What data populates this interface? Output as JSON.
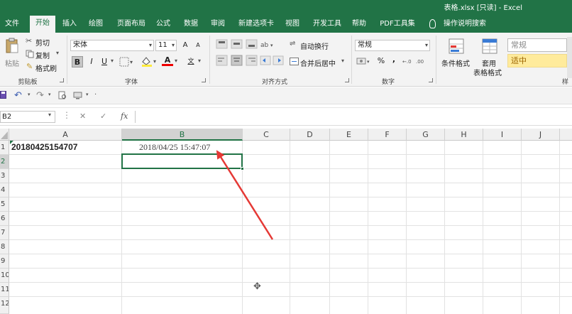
{
  "window": {
    "title": "表格.xlsx  [只读]  -  Excel"
  },
  "tabs": [
    {
      "label": "文件",
      "active": false
    },
    {
      "label": "开始",
      "active": true
    },
    {
      "label": "插入",
      "active": false
    },
    {
      "label": "绘图",
      "active": false
    },
    {
      "label": "页面布局",
      "active": false
    },
    {
      "label": "公式",
      "active": false
    },
    {
      "label": "数据",
      "active": false
    },
    {
      "label": "审阅",
      "active": false
    },
    {
      "label": "新建选项卡",
      "active": false
    },
    {
      "label": "视图",
      "active": false
    },
    {
      "label": "开发工具",
      "active": false
    },
    {
      "label": "帮助",
      "active": false
    },
    {
      "label": "PDF工具集",
      "active": false
    }
  ],
  "tell_me": "操作说明搜索",
  "ribbon": {
    "clipboard": {
      "paste": "粘贴",
      "cut": "剪切",
      "copy": "复制",
      "format_painter": "格式刷",
      "label": "剪贴板"
    },
    "font": {
      "font_name": "宋体",
      "font_size": "11",
      "grow": "A",
      "shrink": "A",
      "bold": "B",
      "italic": "I",
      "underline": "U",
      "font_color_glyph": "A",
      "wen": "文",
      "label": "字体"
    },
    "alignment": {
      "wrap_text": "自动换行",
      "merge_center": "合并后居中",
      "label": "对齐方式"
    },
    "number": {
      "format": "常规",
      "percent": "%",
      "comma": ",",
      "label": "数字"
    },
    "styles": {
      "conditional_format": "条件格式",
      "table_format_1": "套用",
      "table_format_2": "表格格式",
      "style_normal": "常规",
      "style_neutral": "适中",
      "label_partial": "样"
    }
  },
  "formula_bar": {
    "name_box": "B2",
    "cancel": "✕",
    "enter": "✓",
    "fx": "fx",
    "content": ""
  },
  "grid": {
    "columns": [
      "A",
      "B",
      "C",
      "D",
      "E",
      "F",
      "G",
      "H",
      "I",
      "J"
    ],
    "selected_column": "B",
    "rows": [
      "1",
      "2",
      "3",
      "4",
      "5",
      "6",
      "7",
      "8",
      "9",
      "10",
      "11",
      "12"
    ],
    "selected_row": "2",
    "cells": {
      "A1": "20180425154707",
      "B1": "2018/04/25  15:47:07"
    },
    "active_cell": "B2"
  },
  "colors": {
    "brand": "#217346",
    "arrow": "#e53935",
    "neutral_style_bg": "#ffeb9c",
    "neutral_style_text": "#9c6500"
  }
}
